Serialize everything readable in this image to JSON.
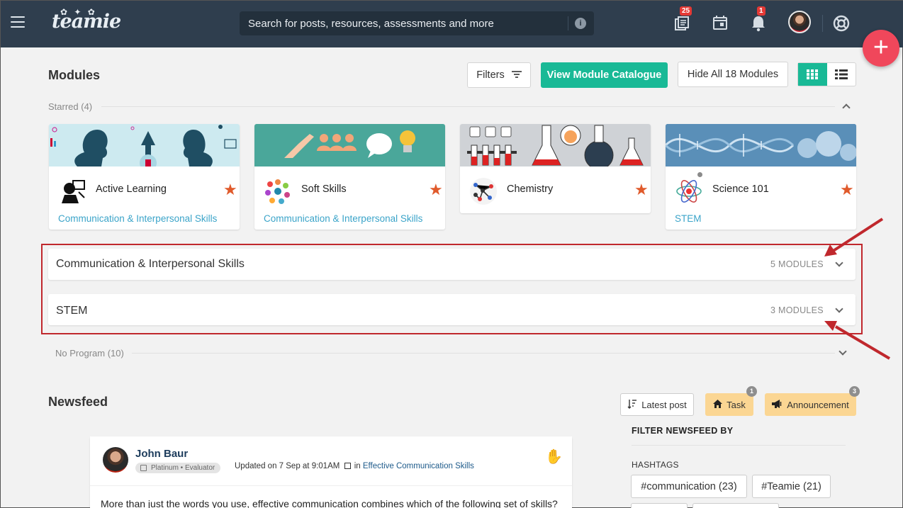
{
  "topbar": {
    "logo": "teamie",
    "search_placeholder": "Search for posts, resources, assessments and more",
    "library_badge": "25",
    "notifications_badge": "1"
  },
  "modules": {
    "title": "Modules",
    "filters_label": "Filters",
    "catalogue_label": "View Module Catalogue",
    "hide_label": "Hide All 18 Modules",
    "starred_label": "Starred (4)",
    "cards": [
      {
        "title": "Active Learning",
        "program": "Communication & Interpersonal Skills"
      },
      {
        "title": "Soft Skills",
        "program": "Communication & Interpersonal Skills"
      },
      {
        "title": "Chemistry",
        "program": ""
      },
      {
        "title": "Science 101",
        "program": "STEM"
      }
    ],
    "programs": [
      {
        "name": "Communication & Interpersonal Skills",
        "count": "5 MODULES"
      },
      {
        "name": "STEM",
        "count": "3 MODULES"
      }
    ],
    "no_program_label": "No Program (10)"
  },
  "newsfeed": {
    "title": "Newsfeed",
    "sort_label": "Latest post",
    "task_label": "Task",
    "task_count": "1",
    "announcement_label": "Announcement",
    "announcement_count": "3",
    "filter_heading": "FILTER NEWSFEED BY",
    "hashtags_heading": "HASHTAGS",
    "hashtags": [
      "#communication (23)",
      "#Teamie (21)"
    ],
    "post": {
      "author": "John Baur",
      "tag": "Platinum • Evaluator",
      "updated": "Updated on 7 Sep at 9:01AM",
      "in_label": "in",
      "group": "Effective Communication Skills",
      "text": "More than just the words you use, effective communication combines which of the following set of skills?"
    }
  },
  "colors": {
    "topbar": "#2f3e4e",
    "accent_green": "#19b996",
    "fab_red": "#f0475b",
    "star_orange": "#e05a2b",
    "link_blue": "#3ba4c9",
    "highlight_red": "#c0282d"
  }
}
